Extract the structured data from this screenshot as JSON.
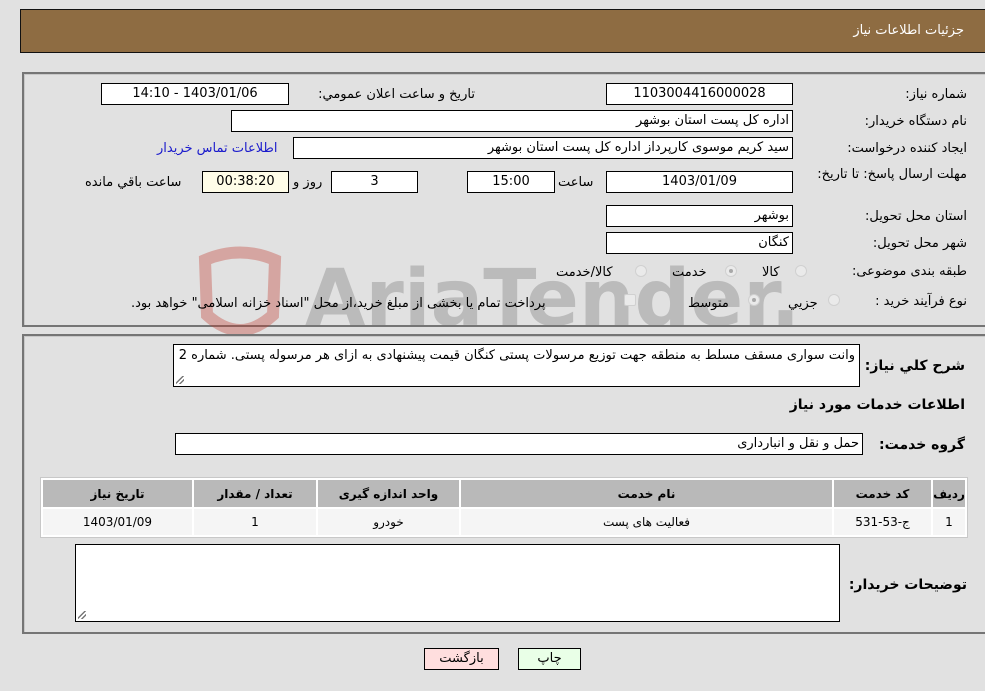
{
  "header": {
    "title": "جزئیات اطلاعات نیاز"
  },
  "form": {
    "need_number": {
      "label": "شماره نیاز:",
      "value": "1103004416000028"
    },
    "announce_datetime": {
      "label": "تاریخ و ساعت اعلان عمومي:",
      "value": "1403/01/06 - 14:10"
    },
    "buyer_org": {
      "label": "نام دستگاه خریدار:",
      "value": "اداره کل پست استان بوشهر"
    },
    "requester": {
      "label": "ایجاد کننده درخواست:",
      "value": "سید کریم موسوی کارپرداز اداره کل پست استان بوشهر"
    },
    "buyer_contact_link": "اطلاعات تماس خریدار",
    "deadline": {
      "label": "مهلت ارسال پاسخ: تا تاریخ:",
      "date": "1403/01/09",
      "time_label": "ساعت",
      "time": "15:00",
      "days": "3",
      "days_label": "روز و",
      "remaining": "00:38:20",
      "remaining_label": "ساعت باقي مانده"
    },
    "delivery_province": {
      "label": "استان محل تحویل:",
      "value": "بوشهر"
    },
    "delivery_city": {
      "label": "شهر محل تحویل:",
      "value": "کنگان"
    },
    "category": {
      "label": "طبقه بندی موضوعی:",
      "options": [
        "کالا",
        "خدمت",
        "کالا/خدمت"
      ],
      "selected": "خدمت"
    },
    "purchase_process": {
      "label": "نوع فرآیند خرید :",
      "options": [
        "جزیي",
        "متوسط"
      ],
      "selected": "متوسط",
      "treasury_checkbox_label": "پرداخت تمام یا بخشی از مبلغ خرید،از محل \"اسناد خزانه اسلامی\" خواهد بود.",
      "treasury_checked": false
    }
  },
  "details": {
    "description_label": "شرح کلي نیاز:",
    "description": "وانت سواری مسقف مسلط به منطقه جهت توزیع مرسولات پستی کنگان قیمت پیشنهادی به ازای هر مرسوله پستی. شماره 2",
    "services_heading": "اطلاعات خدمات مورد نیاز",
    "service_group_label": "گروه خدمت:",
    "service_group": "حمل و نقل و انبارداری",
    "table": {
      "headers": [
        "ردیف",
        "کد خدمت",
        "نام خدمت",
        "واحد اندازه گیری",
        "تعداد / مقدار",
        "تاریخ نیاز"
      ],
      "rows": [
        [
          "1",
          "ج-53-531",
          "فعالیت های پست",
          "خودرو",
          "1",
          "1403/01/09"
        ]
      ]
    },
    "buyer_notes_label": "توضیحات خریدار:",
    "buyer_notes": ""
  },
  "buttons": {
    "print": "چاپ",
    "back": "بازگشت"
  },
  "watermark": {
    "text": "AriaTender.neT"
  }
}
